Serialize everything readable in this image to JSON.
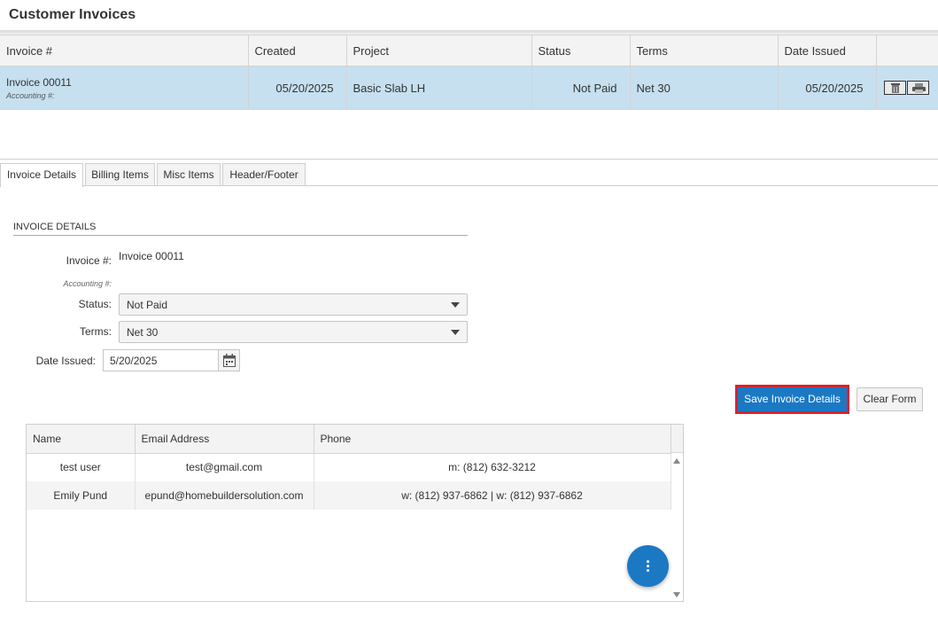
{
  "page": {
    "title": "Customer Invoices"
  },
  "invoice_table": {
    "columns": [
      "Invoice #",
      "Created",
      "Project",
      "Status",
      "Terms",
      "Date Issued",
      ""
    ],
    "rows": [
      {
        "invoice": "Invoice 00011",
        "accounting": "Accounting #:",
        "created": "05/20/2025",
        "project": "Basic Slab LH",
        "status": "Not Paid",
        "terms": "Net 30",
        "date_issued": "05/20/2025",
        "actions": [
          "trash-icon",
          "printer-icon"
        ]
      }
    ]
  },
  "tabs": [
    "Invoice Details",
    "Billing Items",
    "Misc Items",
    "Header/Footer"
  ],
  "details": {
    "section_title": "INVOICE DETAILS",
    "invoice_label": "Invoice #:",
    "invoice_value": "Invoice 00011",
    "accounting_label": "Accounting #:",
    "status_label": "Status:",
    "status_value": "Not Paid",
    "terms_label": "Terms:",
    "terms_value": "Net 30",
    "date_label": "Date Issued:",
    "date_value": "5/20/2025",
    "calendar_icon": "calendar-icon"
  },
  "buttons": {
    "save": "Save Invoice Details",
    "clear": "Clear Form"
  },
  "contacts_table": {
    "columns": [
      "Name",
      "Email Address",
      "Phone"
    ],
    "rows": [
      {
        "name": "test user",
        "email": "test@gmail.com",
        "phone": "m: (812) 632-3212"
      },
      {
        "name": "Emily Pund",
        "email": "epund@homebuildersolution.com",
        "phone": "w: (812) 937-6862 | w: (812) 937-6862"
      }
    ]
  },
  "fab": {
    "icon": "more-vertical-icon"
  },
  "colors": {
    "selected_row": "#c6e0f0",
    "primary": "#1b79c4",
    "highlight_border": "#d9232d"
  }
}
